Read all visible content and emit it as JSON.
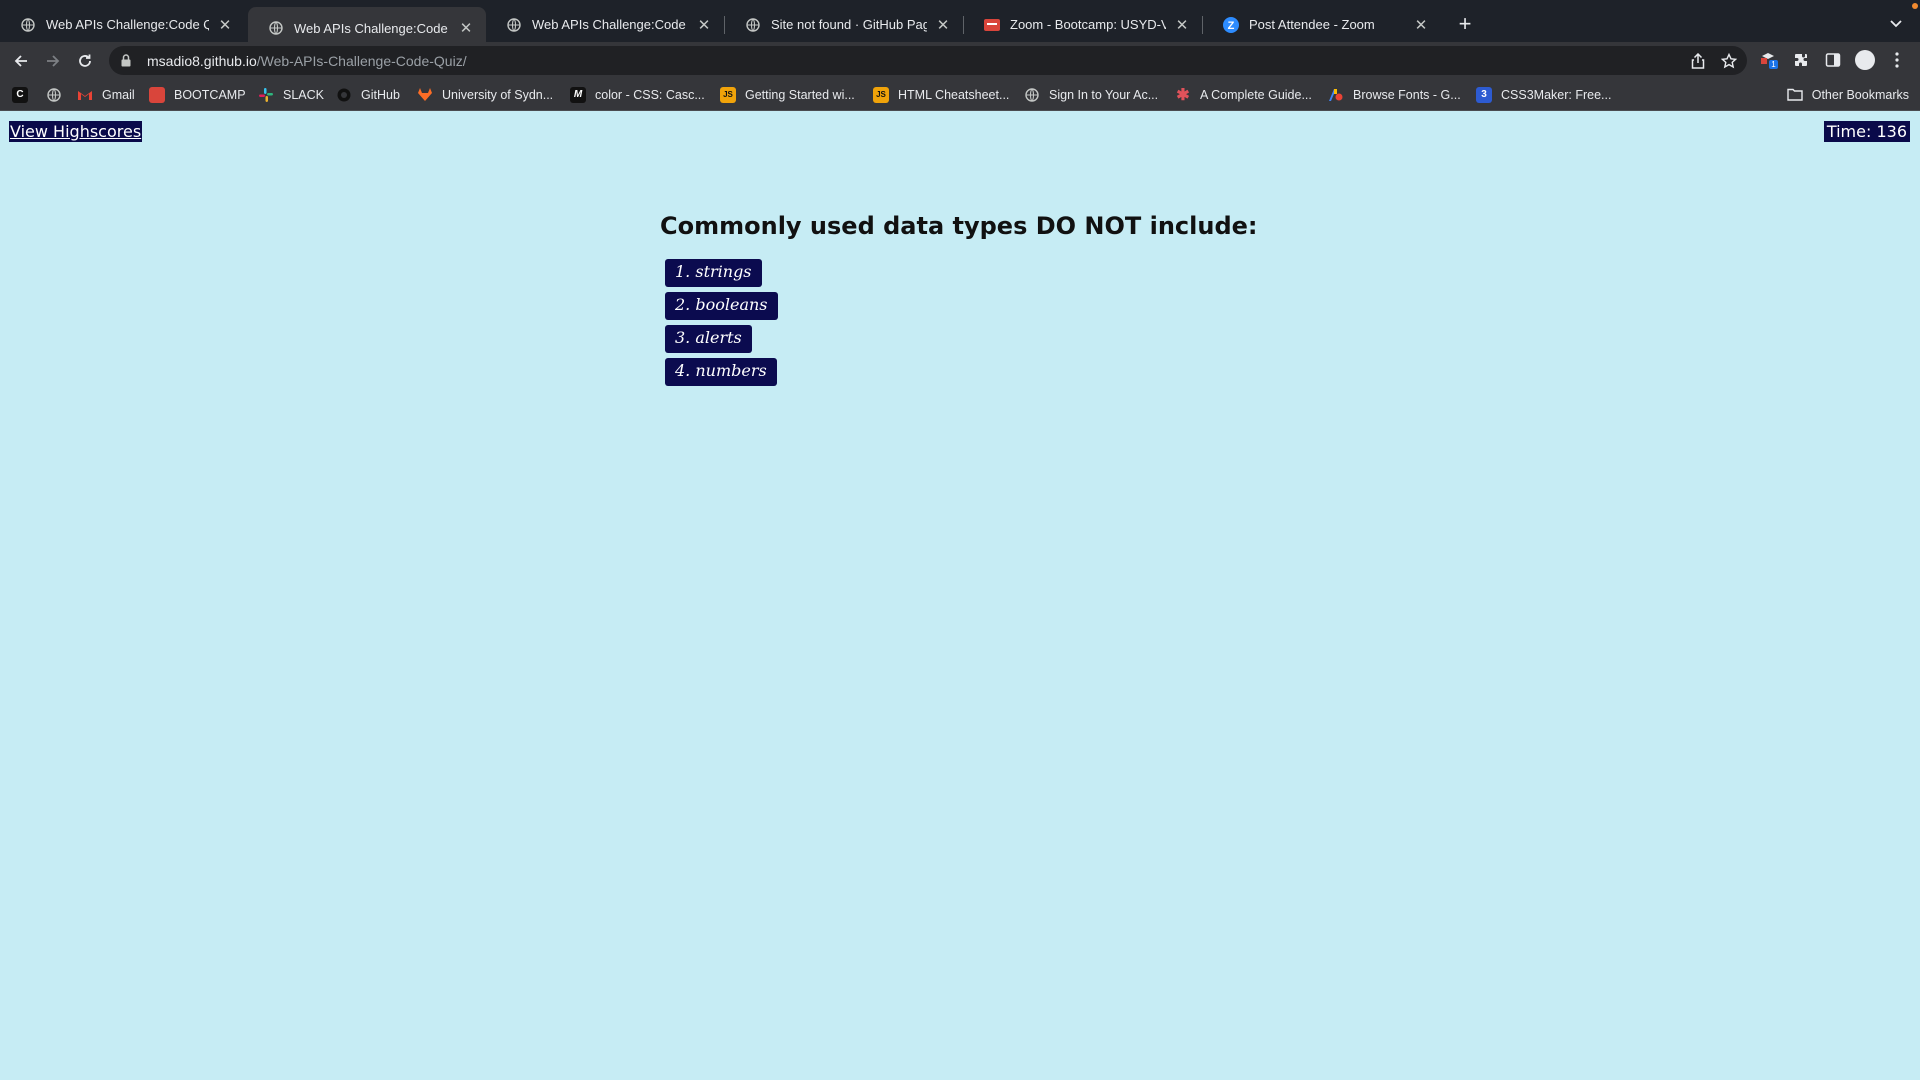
{
  "browser": {
    "tabs": [
      {
        "title": "Web APIs Challenge:Code Quiz",
        "icon": "globe-icon",
        "active": false
      },
      {
        "title": "Web APIs Challenge:Code Quiz",
        "icon": "globe-icon",
        "active": true
      },
      {
        "title": "Web APIs Challenge:Code Quiz",
        "icon": "globe-icon",
        "active": false
      },
      {
        "title": "Site not found · GitHub Pages",
        "icon": "globe-icon",
        "active": false
      },
      {
        "title": "Zoom - Bootcamp: USYD-VIRT",
        "icon": "zoom-bootcamp-icon",
        "active": false
      },
      {
        "title": "Post Attendee - Zoom",
        "icon": "zoom-icon",
        "active": false
      }
    ],
    "address": {
      "host": "msadio8.github.io",
      "path": "/Web-APIs-Challenge-Code-Quiz/"
    },
    "bookmarks": [
      {
        "label": "",
        "icon": "app-icon"
      },
      {
        "label": "",
        "icon": "globe-icon"
      },
      {
        "label": "Gmail",
        "icon": "gmail-icon"
      },
      {
        "label": "BOOTCAMP",
        "icon": "bootcamp-icon"
      },
      {
        "label": "SLACK",
        "icon": "slack-icon"
      },
      {
        "label": "GitHub",
        "icon": "github-icon"
      },
      {
        "label": "University of Sydn...",
        "icon": "gitlab-icon"
      },
      {
        "label": "color - CSS: Casc...",
        "icon": "mdn-icon"
      },
      {
        "label": "Getting Started wi...",
        "icon": "js-icon"
      },
      {
        "label": "HTML Cheatsheet...",
        "icon": "js-icon"
      },
      {
        "label": "Sign In to Your Ac...",
        "icon": "globe-icon"
      },
      {
        "label": "A Complete Guide...",
        "icon": "asterisk-icon"
      },
      {
        "label": "Browse Fonts - G...",
        "icon": "google-fonts-icon"
      },
      {
        "label": "CSS3Maker: Free...",
        "icon": "css3maker-icon"
      }
    ],
    "other_bookmarks": "Other Bookmarks"
  },
  "page": {
    "highscores_label": "View Highscores",
    "timer_text": "Time: 136",
    "question": "Commonly used data types DO NOT include:",
    "answers": [
      "1. strings",
      "2. booleans",
      "3. alerts",
      "4. numbers"
    ],
    "colors": {
      "background": "#c6ecf4",
      "button": "#0b0b4f",
      "button_text": "#ffffff"
    }
  }
}
